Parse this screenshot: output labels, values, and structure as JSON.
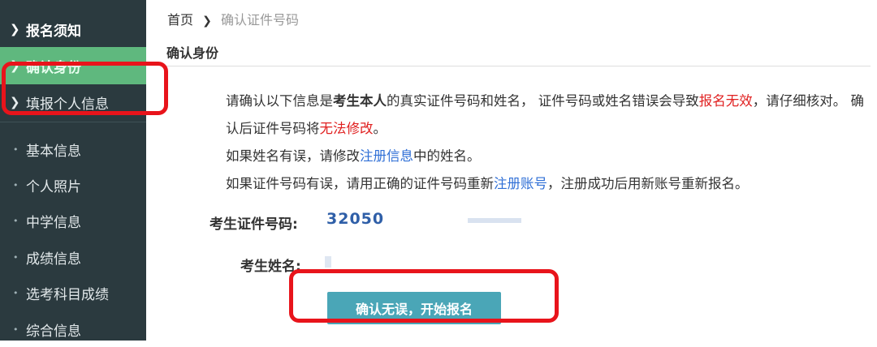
{
  "sidebar": {
    "items": [
      {
        "label": "报名须知"
      },
      {
        "label": "确认身份"
      },
      {
        "label": "填报个人信息"
      }
    ],
    "chevron_icon": "chevron-right-icon",
    "sub_items": [
      {
        "label": "基本信息"
      },
      {
        "label": "个人照片"
      },
      {
        "label": "中学信息"
      },
      {
        "label": "成绩信息"
      },
      {
        "label": "选考科目成绩"
      },
      {
        "label": "综合信息"
      }
    ]
  },
  "breadcrumb": {
    "home": "首页",
    "current": "确认证件号码"
  },
  "section": {
    "title": "确认身份"
  },
  "notice": {
    "p1_a": "请确认以下信息是",
    "p1_b": "考生本人",
    "p1_c": "的真实证件号码和姓名， 证件号码或姓名错误会导致",
    "p1_d": "报名无效",
    "p1_e": "，请仔细核对。 确认后证件号码将",
    "p1_f": "无法修改",
    "p1_g": "。",
    "p2_a": "如果姓名有误，请修改",
    "p2_link": "注册信息",
    "p2_b": "中的姓名。",
    "p3_a": "如果证件号码有误，请用正确的证件号码重新",
    "p3_link": "注册账号",
    "p3_b": "，注册成功后用新账号重新报名。"
  },
  "fields": {
    "id_label": "考生证件号码:",
    "id_value": "32050",
    "name_label": "考生姓名:",
    "name_value": ""
  },
  "actions": {
    "confirm_label": "确认无误，开始报名"
  },
  "colors": {
    "sidebar_bg": "#2b3a3f",
    "active_bg": "#5fb87e",
    "button_bg": "#4aa6b7",
    "highlight_box": "#e8141b",
    "warning_text": "#e02020",
    "link_text": "#2f6fd6"
  }
}
